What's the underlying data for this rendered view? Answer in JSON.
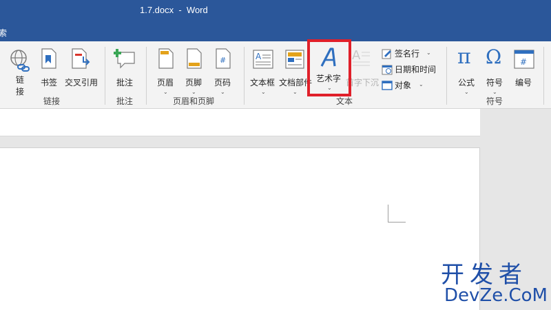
{
  "window": {
    "title": "1.7.docx  -  Word"
  },
  "tabs": {
    "partial_label": "索"
  },
  "ribbon": {
    "links": {
      "group_label": "链接",
      "link_label": "链\n接",
      "link_label_line1": "链",
      "link_label_line2": "接",
      "bookmark_label": "书签",
      "crossref_label": "交叉引用"
    },
    "comments": {
      "group_label": "批注",
      "comment_label": "批注"
    },
    "header_footer": {
      "group_label": "页眉和页脚",
      "header_label": "页眉",
      "footer_label": "页脚",
      "page_number_label": "页码"
    },
    "text": {
      "group_label": "文本",
      "textbox_label": "文本框",
      "quickparts_label": "文档部件",
      "wordart_label": "艺术字",
      "dropcap_label": "首字下沉",
      "signature_label": "签名行",
      "datetime_label": "日期和时间",
      "object_label": "对象"
    },
    "symbols": {
      "group_label": "符号",
      "equation_label": "公式",
      "symbol_label": "符号",
      "numbering_label": "编号"
    }
  },
  "watermark": {
    "line1": "开发者",
    "line2": "DevZe.CoM"
  },
  "colors": {
    "accent": "#2b579a",
    "highlight": "#e0202a",
    "watermark": "#1f4fa8"
  }
}
